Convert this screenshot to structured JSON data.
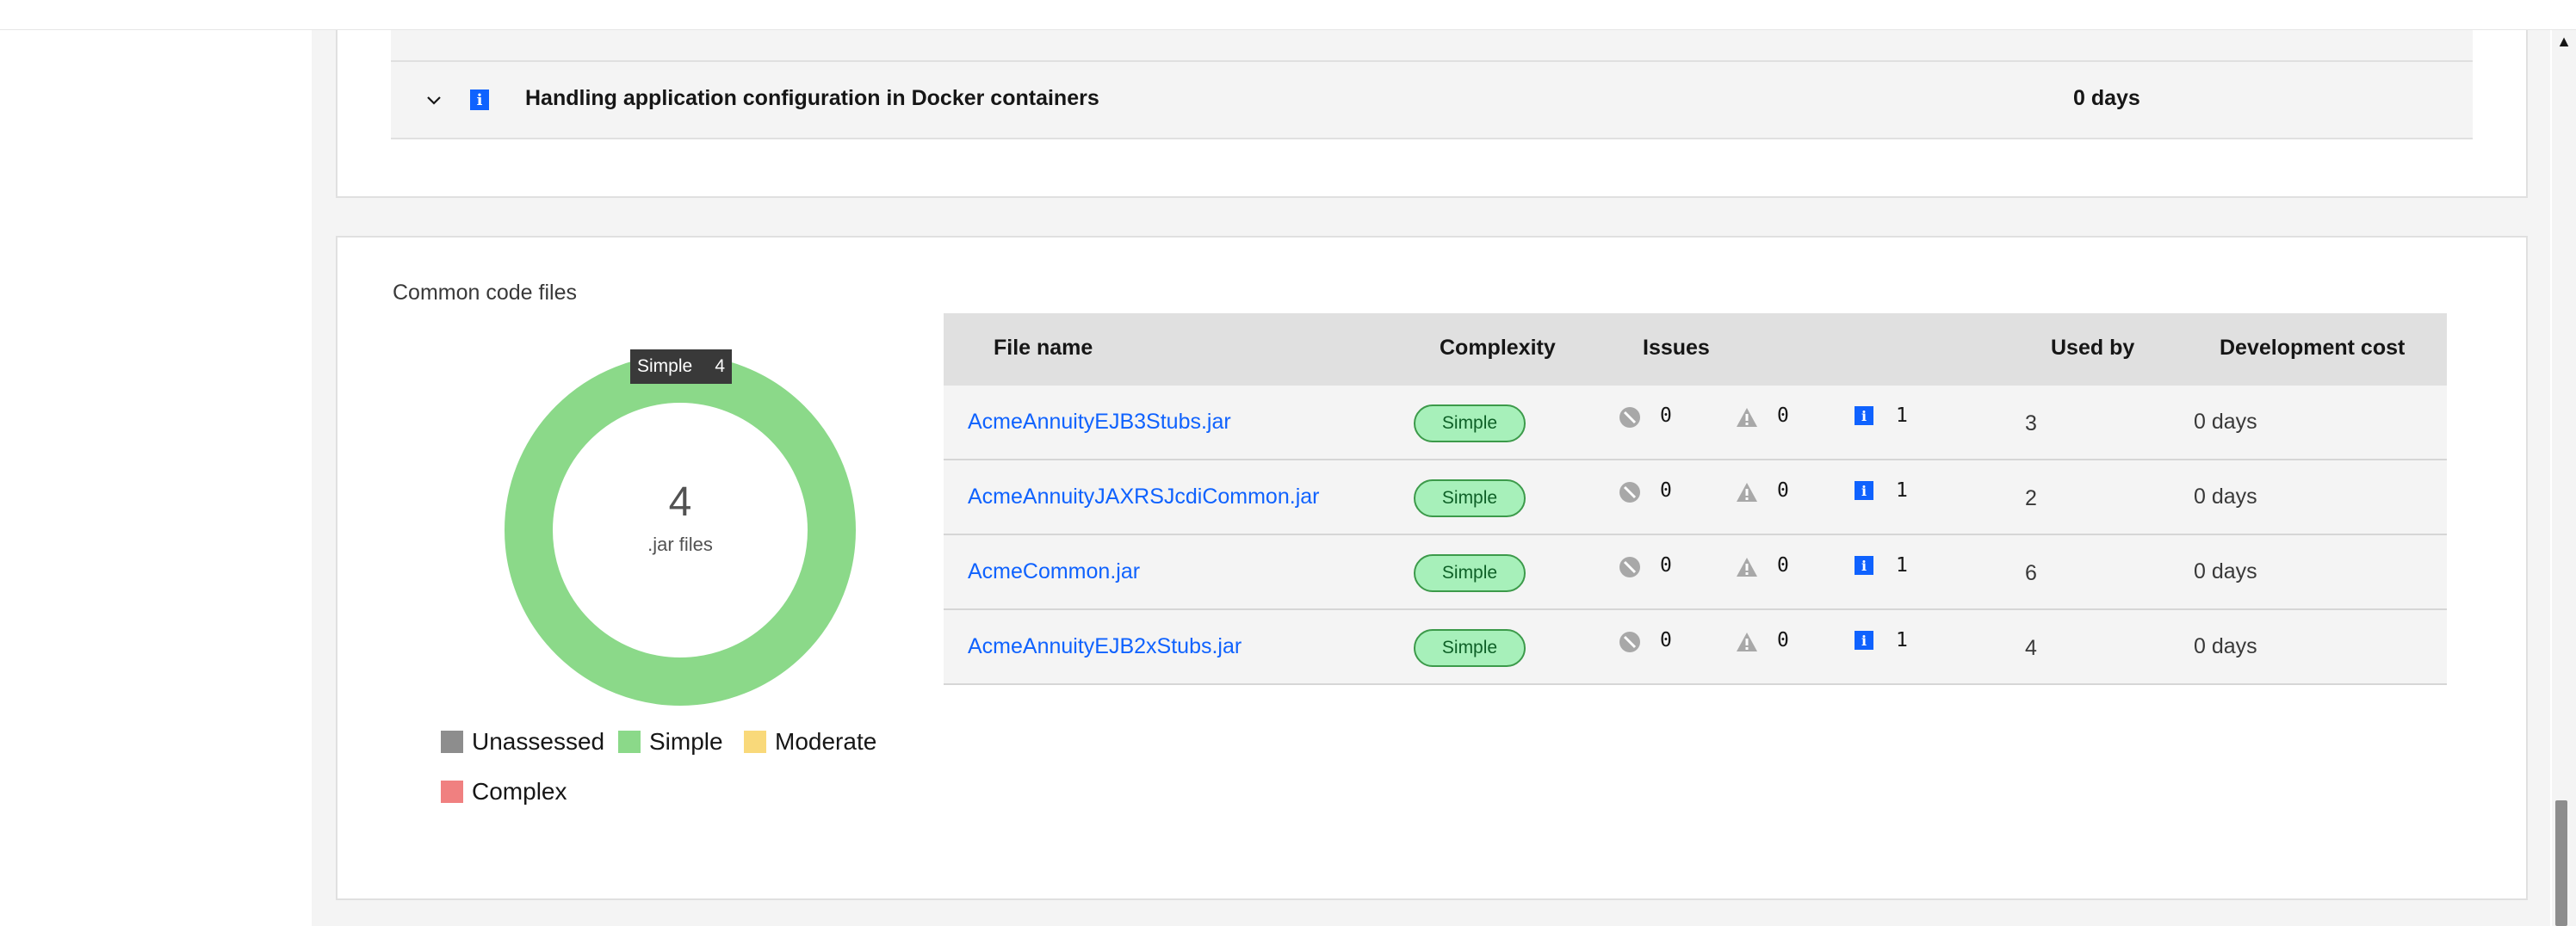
{
  "issues_panel": {
    "previous_row": {
      "title": "",
      "days": ""
    },
    "docker_row": {
      "title": "Handling application configuration in Docker containers",
      "days": "0 days"
    }
  },
  "common_code": {
    "section_title": "Common code files",
    "donut": {
      "total": "4",
      "unit_label": ".jar files",
      "tooltip_label": "Simple",
      "tooltip_value": "4"
    },
    "legend": [
      "Unassessed",
      "Simple",
      "Moderate",
      "Complex"
    ],
    "colors": {
      "unassessed": "#8d8d8d",
      "simple": "#8bd989",
      "moderate": "#f9d97a",
      "complex": "#f08080",
      "link": "#0f62fe"
    },
    "table": {
      "headers": [
        "File name",
        "Complexity",
        "Issues",
        "Used by",
        "Development cost"
      ],
      "rows": [
        {
          "file": "AcmeAnnuityEJB3Stubs.jar",
          "complexity": "Simple",
          "critical": "0",
          "warning": "0",
          "info": "1",
          "used_by": "3",
          "cost": "0 days"
        },
        {
          "file": "AcmeAnnuityJAXRSJcdiCommon.jar",
          "complexity": "Simple",
          "critical": "0",
          "warning": "0",
          "info": "1",
          "used_by": "2",
          "cost": "0 days"
        },
        {
          "file": "AcmeCommon.jar",
          "complexity": "Simple",
          "critical": "0",
          "warning": "0",
          "info": "1",
          "used_by": "6",
          "cost": "0 days"
        },
        {
          "file": "AcmeAnnuityEJB2xStubs.jar",
          "complexity": "Simple",
          "critical": "0",
          "warning": "0",
          "info": "1",
          "used_by": "4",
          "cost": "0 days"
        }
      ]
    }
  },
  "icons": [
    "chevron-down-icon",
    "info-icon",
    "critical-icon",
    "warning-icon",
    "scroll-up-icon"
  ]
}
